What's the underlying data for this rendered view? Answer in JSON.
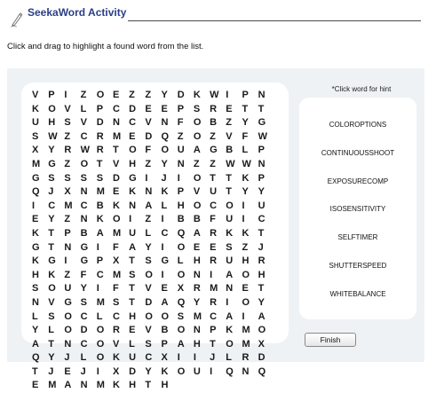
{
  "header": {
    "title": "SeekaWord Activity",
    "icon": "pencil-icon"
  },
  "instruction": "Click and drag to highlight a found word from the list.",
  "puzzle": {
    "rows": [
      [
        "V",
        "P",
        "I",
        "Z",
        "O",
        "E",
        "Z",
        "Z",
        "Y",
        "D",
        "K",
        "W",
        "I",
        "P",
        "N",
        "K",
        "O",
        "V"
      ],
      [
        "L",
        "P",
        "C",
        "D",
        "E",
        "E",
        "P",
        "S",
        "R",
        "E",
        "T",
        "T",
        "U",
        "H",
        "S",
        "V",
        "D",
        "N"
      ],
      [
        "C",
        "V",
        "N",
        "F",
        "O",
        "B",
        "Z",
        "Y",
        "G",
        "S",
        "W",
        "Z",
        "C",
        "R",
        "M",
        "E",
        "D",
        "Q"
      ],
      [
        "Z",
        "O",
        "Z",
        "V",
        "F",
        "W",
        "X",
        "Y",
        "R",
        "W",
        "R",
        "T",
        "O",
        "F",
        "O",
        "U",
        "A",
        "G"
      ],
      [
        "B",
        "L",
        "P",
        "M",
        "G",
        "Z",
        "O",
        "T",
        "V",
        "H",
        "Z",
        "Y",
        "N",
        "Z",
        "Z",
        "W",
        "W",
        "N"
      ],
      [
        "G",
        "S",
        "S",
        "S",
        "S",
        "D",
        "G",
        "I",
        "J",
        "I",
        "O",
        "T",
        "T",
        "K",
        "P",
        "Q",
        "J",
        "X"
      ],
      [
        "N",
        "M",
        "E",
        "K",
        "N",
        "K",
        "P",
        "V",
        "U",
        "T",
        "Y",
        "Y",
        "I",
        "C",
        "M",
        "C",
        "B",
        "K"
      ],
      [
        "N",
        "A",
        "L",
        "H",
        "O",
        "C",
        "O",
        "I",
        "U",
        "E",
        "Y",
        "Z",
        "N",
        "K",
        "O",
        "I",
        "Z",
        "I"
      ],
      [
        "B",
        "B",
        "F",
        "U",
        "I",
        "C",
        "K",
        "T",
        "P",
        "B",
        "A",
        "M",
        "U",
        "L",
        "C",
        "Q",
        "A",
        "R"
      ],
      [
        "K",
        "K",
        "T",
        "G",
        "T",
        "N",
        "G",
        "I",
        "F",
        "A",
        "Y",
        "I",
        "O",
        "E",
        "E",
        "S",
        "Z",
        "J"
      ],
      [
        "K",
        "G",
        "I",
        "G",
        "P",
        "X",
        "T",
        "S",
        "G",
        "L",
        "H",
        "R",
        "U",
        "H",
        "R",
        "H",
        "K",
        "Z"
      ],
      [
        "F",
        "C",
        "M",
        "S",
        "O",
        "I",
        "O",
        "N",
        "I",
        "A",
        "O",
        "H",
        "S",
        "O",
        "U",
        "Y",
        "I",
        "F"
      ],
      [
        "T",
        "V",
        "E",
        "X",
        "R",
        "M",
        "N",
        "E",
        "T",
        "N",
        "V",
        "G",
        "S",
        "M",
        "S",
        "T",
        "D",
        "A"
      ],
      [
        "Q",
        "Y",
        "R",
        "I",
        "O",
        "Y",
        "L",
        "S",
        "O",
        "C",
        "L",
        "C",
        "H",
        "O",
        "O",
        "S",
        "M",
        "C"
      ],
      [
        "A",
        "I",
        "A",
        "Y",
        "L",
        "O",
        "D",
        "O",
        "R",
        "E",
        "V",
        "B",
        "O",
        "N",
        "P",
        "K",
        "M",
        "O"
      ],
      [
        "A",
        "T",
        "N",
        "C",
        "O",
        "V",
        "L",
        "S",
        "P",
        "A",
        "H",
        "T",
        "O",
        "M",
        "X",
        "Q",
        "Y",
        "J"
      ],
      [
        "L",
        "O",
        "K",
        "U",
        "C",
        "X",
        "I",
        "I",
        "J",
        "L",
        "R",
        "D",
        "T",
        "J",
        "E",
        "J",
        "I",
        "X"
      ],
      [
        "D",
        "Y",
        "K",
        "O",
        "U",
        "I",
        "Q",
        "N",
        "Q",
        "E",
        "M",
        "A",
        "N",
        "M",
        "K",
        "H",
        "T",
        "H"
      ]
    ]
  },
  "word_list": {
    "caption": "*Click word for hint",
    "words": [
      "COLOROPTIONS",
      "CONTINUOUSSHOOT",
      "EXPOSURECOMP",
      "ISOSENSITIVITY",
      "SELFTIMER",
      "SHUTTERSPEED",
      "WHITEBALANCE"
    ]
  },
  "finish_label": "Finish"
}
